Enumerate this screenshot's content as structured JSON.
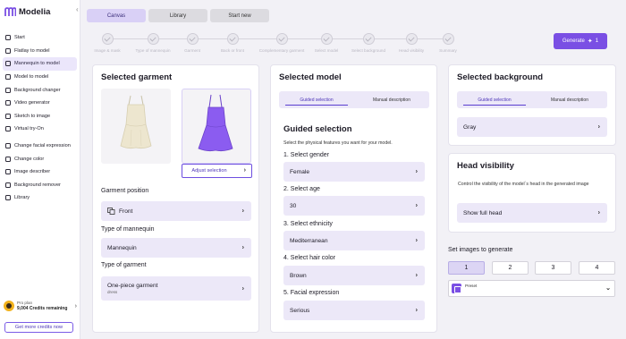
{
  "brand": {
    "name": "Modelia",
    "color": "#7a4fe4"
  },
  "sidebar": {
    "items": [
      {
        "label": "Start",
        "icon": "home-icon"
      },
      {
        "label": "Flatlay to model",
        "icon": "flatlay-icon"
      },
      {
        "label": "Mannequin to model",
        "icon": "mannequin-icon",
        "active": true
      },
      {
        "label": "Model to model",
        "icon": "model-icon"
      },
      {
        "label": "Background changer",
        "icon": "background-icon"
      },
      {
        "label": "Video generator",
        "icon": "video-icon"
      },
      {
        "label": "Sketch to image",
        "icon": "sketch-icon"
      },
      {
        "label": "Virtual try-On",
        "icon": "tryon-icon"
      },
      {
        "label": "Change facial expression",
        "icon": "face-icon"
      },
      {
        "label": "Change color",
        "icon": "palette-icon"
      },
      {
        "label": "Image describer",
        "icon": "describe-icon"
      },
      {
        "label": "Background remover",
        "icon": "remove-bg-icon"
      },
      {
        "label": "Library",
        "icon": "library-icon"
      }
    ],
    "plan": {
      "name": "Pro plan",
      "credits": "9,004 Credits remaining"
    },
    "get_credits": "Get more credits now"
  },
  "tabs": [
    {
      "label": "Canvas",
      "active": true
    },
    {
      "label": "Library"
    },
    {
      "label": "Start new"
    }
  ],
  "steps": [
    {
      "label": "Image & mask"
    },
    {
      "label": "Type of mannequin"
    },
    {
      "label": "Garment"
    },
    {
      "label": "Back or front"
    },
    {
      "label": "Complementary garment"
    },
    {
      "label": "Select model"
    },
    {
      "label": "Select background"
    },
    {
      "label": "Head visibility"
    },
    {
      "label": "Summary"
    }
  ],
  "generate": {
    "label": "Generate",
    "count": "1"
  },
  "garment": {
    "title": "Selected garment",
    "adjust": "Adjust selection",
    "position_label": "Garment position",
    "position_value": "Front",
    "mannequin_label": "Type of mannequin",
    "mannequin_value": "Mannequin",
    "type_label": "Type of garment",
    "type_value": "One-piece garment",
    "type_sub": "dress"
  },
  "model": {
    "title": "Selected model",
    "tab_guided": "Guided selection",
    "tab_manual": "Manual description",
    "guided_title": "Guided selection",
    "guided_desc": "Select the physical features you want for your model.",
    "gender_label": "1. Select gender",
    "gender_value": "Female",
    "age_label": "2. Select age",
    "age_value": "30",
    "ethnicity_label": "3. Select ethnicity",
    "ethnicity_value": "Mediterranean",
    "hair_label": "4. Select hair color",
    "hair_value": "Brown",
    "expression_label": "5. Facial expression",
    "expression_value": "Serious"
  },
  "background": {
    "title": "Selected background",
    "tab_guided": "Guided selection",
    "tab_manual": "Manual description",
    "value": "Gray"
  },
  "head": {
    "title": "Head visibility",
    "desc": "Control the visibility of the model´s head in the generated image",
    "value": "Show full head"
  },
  "images": {
    "label": "Set images to generate",
    "options": [
      "1",
      "2",
      "3",
      "4"
    ],
    "selected": "1",
    "preset": "Preset"
  }
}
